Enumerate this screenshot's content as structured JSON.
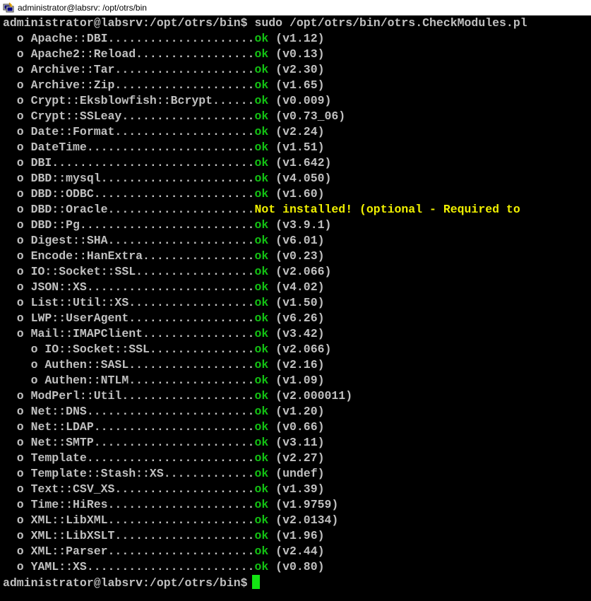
{
  "window": {
    "title": "administrator@labsrv: /opt/otrs/bin"
  },
  "terminal": {
    "prompt": "administrator@labsrv:/opt/otrs/bin$",
    "command": "sudo /opt/otrs/bin/otrs.CheckModules.pl",
    "modules": [
      {
        "label": "  o Apache::DBI.....................",
        "status": "ok",
        "info": " (v1.12)",
        "state": "ok"
      },
      {
        "label": "  o Apache2::Reload.................",
        "status": "ok",
        "info": " (v0.13)",
        "state": "ok"
      },
      {
        "label": "  o Archive::Tar....................",
        "status": "ok",
        "info": " (v2.30)",
        "state": "ok"
      },
      {
        "label": "  o Archive::Zip....................",
        "status": "ok",
        "info": " (v1.65)",
        "state": "ok"
      },
      {
        "label": "  o Crypt::Eksblowfish::Bcrypt......",
        "status": "ok",
        "info": " (v0.009)",
        "state": "ok"
      },
      {
        "label": "  o Crypt::SSLeay...................",
        "status": "ok",
        "info": " (v0.73_06)",
        "state": "ok"
      },
      {
        "label": "  o Date::Format....................",
        "status": "ok",
        "info": " (v2.24)",
        "state": "ok"
      },
      {
        "label": "  o DateTime........................",
        "status": "ok",
        "info": " (v1.51)",
        "state": "ok"
      },
      {
        "label": "  o DBI.............................",
        "status": "ok",
        "info": " (v1.642)",
        "state": "ok"
      },
      {
        "label": "  o DBD::mysql......................",
        "status": "ok",
        "info": " (v4.050)",
        "state": "ok"
      },
      {
        "label": "  o DBD::ODBC.......................",
        "status": "ok",
        "info": " (v1.60)",
        "state": "ok"
      },
      {
        "label": "  o DBD::Oracle.....................",
        "status": "Not installed!",
        "info": " (optional - Required to",
        "state": "missing"
      },
      {
        "label": "  o DBD::Pg.........................",
        "status": "ok",
        "info": " (v3.9.1)",
        "state": "ok"
      },
      {
        "label": "  o Digest::SHA.....................",
        "status": "ok",
        "info": " (v6.01)",
        "state": "ok"
      },
      {
        "label": "  o Encode::HanExtra................",
        "status": "ok",
        "info": " (v0.23)",
        "state": "ok"
      },
      {
        "label": "  o IO::Socket::SSL.................",
        "status": "ok",
        "info": " (v2.066)",
        "state": "ok"
      },
      {
        "label": "  o JSON::XS........................",
        "status": "ok",
        "info": " (v4.02)",
        "state": "ok"
      },
      {
        "label": "  o List::Util::XS..................",
        "status": "ok",
        "info": " (v1.50)",
        "state": "ok"
      },
      {
        "label": "  o LWP::UserAgent..................",
        "status": "ok",
        "info": " (v6.26)",
        "state": "ok"
      },
      {
        "label": "  o Mail::IMAPClient................",
        "status": "ok",
        "info": " (v3.42)",
        "state": "ok"
      },
      {
        "label": "    o IO::Socket::SSL...............",
        "status": "ok",
        "info": " (v2.066)",
        "state": "ok"
      },
      {
        "label": "    o Authen::SASL..................",
        "status": "ok",
        "info": " (v2.16)",
        "state": "ok"
      },
      {
        "label": "    o Authen::NTLM..................",
        "status": "ok",
        "info": " (v1.09)",
        "state": "ok"
      },
      {
        "label": "  o ModPerl::Util...................",
        "status": "ok",
        "info": " (v2.000011)",
        "state": "ok"
      },
      {
        "label": "  o Net::DNS........................",
        "status": "ok",
        "info": " (v1.20)",
        "state": "ok"
      },
      {
        "label": "  o Net::LDAP.......................",
        "status": "ok",
        "info": " (v0.66)",
        "state": "ok"
      },
      {
        "label": "  o Net::SMTP.......................",
        "status": "ok",
        "info": " (v3.11)",
        "state": "ok"
      },
      {
        "label": "  o Template........................",
        "status": "ok",
        "info": " (v2.27)",
        "state": "ok"
      },
      {
        "label": "  o Template::Stash::XS.............",
        "status": "ok",
        "info": " (undef)",
        "state": "ok"
      },
      {
        "label": "  o Text::CSV_XS....................",
        "status": "ok",
        "info": " (v1.39)",
        "state": "ok"
      },
      {
        "label": "  o Time::HiRes.....................",
        "status": "ok",
        "info": " (v1.9759)",
        "state": "ok"
      },
      {
        "label": "  o XML::LibXML.....................",
        "status": "ok",
        "info": " (v2.0134)",
        "state": "ok"
      },
      {
        "label": "  o XML::LibXSLT....................",
        "status": "ok",
        "info": " (v1.96)",
        "state": "ok"
      },
      {
        "label": "  o XML::Parser.....................",
        "status": "ok",
        "info": " (v2.44)",
        "state": "ok"
      },
      {
        "label": "  o YAML::XS........................",
        "status": "ok",
        "info": " (v0.80)",
        "state": "ok"
      }
    ]
  },
  "colors": {
    "background": "#000000",
    "text": "#c0c0c0",
    "ok": "#13c113",
    "missing": "#f0f000",
    "cursor": "#13e313"
  },
  "icons": {
    "app": "putty-terminal-icon"
  }
}
